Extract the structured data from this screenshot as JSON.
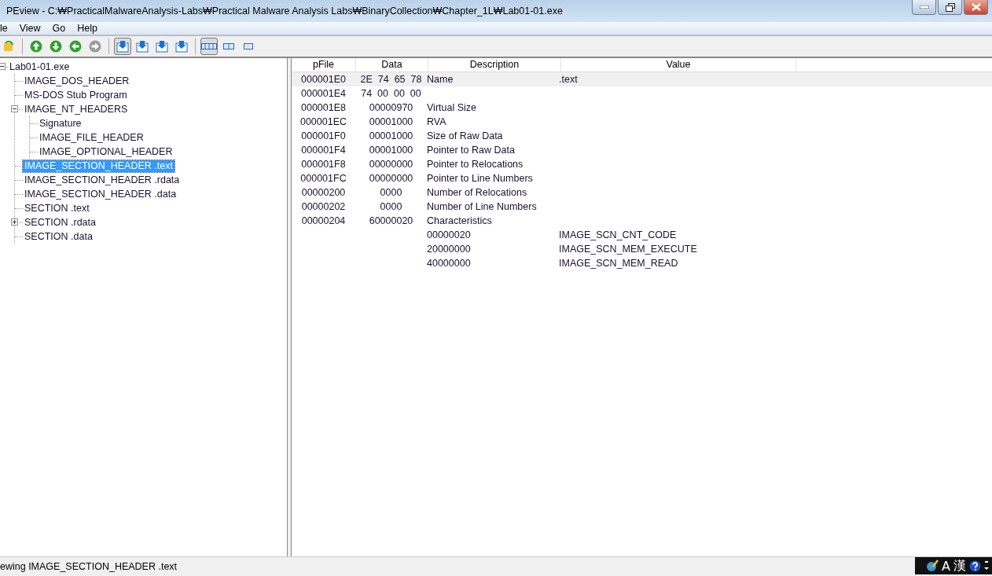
{
  "window": {
    "title": "PEview - C:₩PracticalMalwareAnalysis-Labs₩Practical Malware Analysis Labs₩BinaryCollection₩Chapter_1L₩Lab01-01.exe"
  },
  "menu": [
    "le",
    "View",
    "Go",
    "Help"
  ],
  "toolbar": [
    {
      "kind": "open",
      "disabled": false,
      "pressed": false
    },
    {
      "kind": "sep"
    },
    {
      "kind": "up",
      "disabled": false,
      "pressed": false
    },
    {
      "kind": "down",
      "disabled": false,
      "pressed": false
    },
    {
      "kind": "back",
      "disabled": false,
      "pressed": false
    },
    {
      "kind": "forward",
      "disabled": true,
      "pressed": false
    },
    {
      "kind": "sep"
    },
    {
      "kind": "view-byte",
      "disabled": false,
      "pressed": true
    },
    {
      "kind": "view-word",
      "disabled": false,
      "pressed": false
    },
    {
      "kind": "view-dword",
      "disabled": false,
      "pressed": false
    },
    {
      "kind": "view-qword",
      "disabled": false,
      "pressed": false
    },
    {
      "kind": "sep"
    },
    {
      "kind": "layout-wide",
      "disabled": false,
      "pressed": true
    },
    {
      "kind": "layout-mid",
      "disabled": false,
      "pressed": false
    },
    {
      "kind": "layout-narrow",
      "disabled": false,
      "pressed": false
    }
  ],
  "tree": [
    {
      "label": "Lab01-01.exe",
      "selected": false,
      "expanded": true,
      "children": [
        {
          "label": "IMAGE_DOS_HEADER",
          "selected": false
        },
        {
          "label": "MS-DOS Stub Program",
          "selected": false
        },
        {
          "label": "IMAGE_NT_HEADERS",
          "selected": false,
          "expanded": true,
          "children": [
            {
              "label": "Signature",
              "selected": false
            },
            {
              "label": "IMAGE_FILE_HEADER",
              "selected": false
            },
            {
              "label": "IMAGE_OPTIONAL_HEADER",
              "selected": false
            }
          ]
        },
        {
          "label": "IMAGE_SECTION_HEADER .text",
          "selected": true
        },
        {
          "label": "IMAGE_SECTION_HEADER .rdata",
          "selected": false
        },
        {
          "label": "IMAGE_SECTION_HEADER .data",
          "selected": false
        },
        {
          "label": "SECTION .text",
          "selected": false
        },
        {
          "label": "SECTION .rdata",
          "selected": false,
          "expanded": false
        },
        {
          "label": "SECTION .data",
          "selected": false
        }
      ]
    }
  ],
  "table": {
    "columns": [
      "pFile",
      "Data",
      "Description",
      "Value"
    ],
    "rows": [
      {
        "pfile": "000001E0",
        "data": "2E  74  65  78",
        "description": "Name",
        "value": ".text",
        "selected": true
      },
      {
        "pfile": "000001E4",
        "data": "74  00  00  00",
        "selected": false
      },
      {
        "pfile": "000001E8",
        "data": "00000970",
        "description": "Virtual Size",
        "selected": false
      },
      {
        "pfile": "000001EC",
        "data": "00001000",
        "description": "RVA",
        "selected": false
      },
      {
        "pfile": "000001F0",
        "data": "00001000",
        "description": "Size of Raw Data",
        "selected": false
      },
      {
        "pfile": "000001F4",
        "data": "00001000",
        "description": "Pointer to Raw Data",
        "selected": false
      },
      {
        "pfile": "000001F8",
        "data": "00000000",
        "description": "Pointer to Relocations",
        "selected": false
      },
      {
        "pfile": "000001FC",
        "data": "00000000",
        "description": "Pointer to Line Numbers",
        "selected": false
      },
      {
        "pfile": "00000200",
        "data": "0000",
        "description": "Number of Relocations",
        "selected": false
      },
      {
        "pfile": "00000202",
        "data": "0000",
        "description": "Number of Line Numbers",
        "selected": false
      },
      {
        "pfile": "00000204",
        "data": "60000020",
        "description": "Characteristics",
        "selected": false
      },
      {
        "description": "00000020",
        "value": "IMAGE_SCN_CNT_CODE",
        "selected": false
      },
      {
        "description": "20000000",
        "value": "IMAGE_SCN_MEM_EXECUTE",
        "selected": false
      },
      {
        "description": "40000000",
        "value": "IMAGE_SCN_MEM_READ",
        "selected": false
      }
    ]
  },
  "status_bar": "ewing IMAGE_SECTION_HEADER .text",
  "ime": [
    "A",
    "漢"
  ]
}
